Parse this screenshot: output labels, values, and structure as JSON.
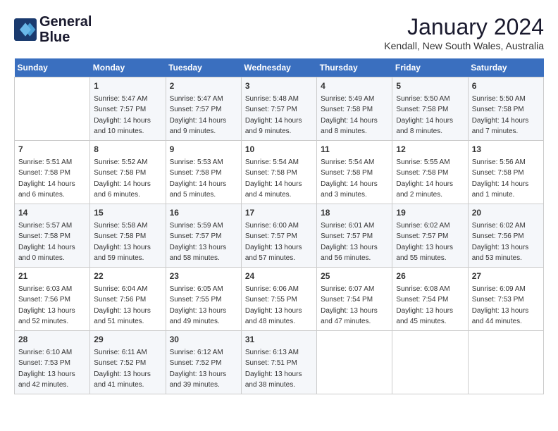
{
  "logo": {
    "line1": "General",
    "line2": "Blue"
  },
  "title": "January 2024",
  "location": "Kendall, New South Wales, Australia",
  "days_of_week": [
    "Sunday",
    "Monday",
    "Tuesday",
    "Wednesday",
    "Thursday",
    "Friday",
    "Saturday"
  ],
  "weeks": [
    [
      {
        "day": "",
        "sunrise": "",
        "sunset": "",
        "daylight": ""
      },
      {
        "day": "1",
        "sunrise": "Sunrise: 5:47 AM",
        "sunset": "Sunset: 7:57 PM",
        "daylight": "Daylight: 14 hours and 10 minutes."
      },
      {
        "day": "2",
        "sunrise": "Sunrise: 5:47 AM",
        "sunset": "Sunset: 7:57 PM",
        "daylight": "Daylight: 14 hours and 9 minutes."
      },
      {
        "day": "3",
        "sunrise": "Sunrise: 5:48 AM",
        "sunset": "Sunset: 7:57 PM",
        "daylight": "Daylight: 14 hours and 9 minutes."
      },
      {
        "day": "4",
        "sunrise": "Sunrise: 5:49 AM",
        "sunset": "Sunset: 7:58 PM",
        "daylight": "Daylight: 14 hours and 8 minutes."
      },
      {
        "day": "5",
        "sunrise": "Sunrise: 5:50 AM",
        "sunset": "Sunset: 7:58 PM",
        "daylight": "Daylight: 14 hours and 8 minutes."
      },
      {
        "day": "6",
        "sunrise": "Sunrise: 5:50 AM",
        "sunset": "Sunset: 7:58 PM",
        "daylight": "Daylight: 14 hours and 7 minutes."
      }
    ],
    [
      {
        "day": "7",
        "sunrise": "Sunrise: 5:51 AM",
        "sunset": "Sunset: 7:58 PM",
        "daylight": "Daylight: 14 hours and 6 minutes."
      },
      {
        "day": "8",
        "sunrise": "Sunrise: 5:52 AM",
        "sunset": "Sunset: 7:58 PM",
        "daylight": "Daylight: 14 hours and 6 minutes."
      },
      {
        "day": "9",
        "sunrise": "Sunrise: 5:53 AM",
        "sunset": "Sunset: 7:58 PM",
        "daylight": "Daylight: 14 hours and 5 minutes."
      },
      {
        "day": "10",
        "sunrise": "Sunrise: 5:54 AM",
        "sunset": "Sunset: 7:58 PM",
        "daylight": "Daylight: 14 hours and 4 minutes."
      },
      {
        "day": "11",
        "sunrise": "Sunrise: 5:54 AM",
        "sunset": "Sunset: 7:58 PM",
        "daylight": "Daylight: 14 hours and 3 minutes."
      },
      {
        "day": "12",
        "sunrise": "Sunrise: 5:55 AM",
        "sunset": "Sunset: 7:58 PM",
        "daylight": "Daylight: 14 hours and 2 minutes."
      },
      {
        "day": "13",
        "sunrise": "Sunrise: 5:56 AM",
        "sunset": "Sunset: 7:58 PM",
        "daylight": "Daylight: 14 hours and 1 minute."
      }
    ],
    [
      {
        "day": "14",
        "sunrise": "Sunrise: 5:57 AM",
        "sunset": "Sunset: 7:58 PM",
        "daylight": "Daylight: 14 hours and 0 minutes."
      },
      {
        "day": "15",
        "sunrise": "Sunrise: 5:58 AM",
        "sunset": "Sunset: 7:58 PM",
        "daylight": "Daylight: 13 hours and 59 minutes."
      },
      {
        "day": "16",
        "sunrise": "Sunrise: 5:59 AM",
        "sunset": "Sunset: 7:57 PM",
        "daylight": "Daylight: 13 hours and 58 minutes."
      },
      {
        "day": "17",
        "sunrise": "Sunrise: 6:00 AM",
        "sunset": "Sunset: 7:57 PM",
        "daylight": "Daylight: 13 hours and 57 minutes."
      },
      {
        "day": "18",
        "sunrise": "Sunrise: 6:01 AM",
        "sunset": "Sunset: 7:57 PM",
        "daylight": "Daylight: 13 hours and 56 minutes."
      },
      {
        "day": "19",
        "sunrise": "Sunrise: 6:02 AM",
        "sunset": "Sunset: 7:57 PM",
        "daylight": "Daylight: 13 hours and 55 minutes."
      },
      {
        "day": "20",
        "sunrise": "Sunrise: 6:02 AM",
        "sunset": "Sunset: 7:56 PM",
        "daylight": "Daylight: 13 hours and 53 minutes."
      }
    ],
    [
      {
        "day": "21",
        "sunrise": "Sunrise: 6:03 AM",
        "sunset": "Sunset: 7:56 PM",
        "daylight": "Daylight: 13 hours and 52 minutes."
      },
      {
        "day": "22",
        "sunrise": "Sunrise: 6:04 AM",
        "sunset": "Sunset: 7:56 PM",
        "daylight": "Daylight: 13 hours and 51 minutes."
      },
      {
        "day": "23",
        "sunrise": "Sunrise: 6:05 AM",
        "sunset": "Sunset: 7:55 PM",
        "daylight": "Daylight: 13 hours and 49 minutes."
      },
      {
        "day": "24",
        "sunrise": "Sunrise: 6:06 AM",
        "sunset": "Sunset: 7:55 PM",
        "daylight": "Daylight: 13 hours and 48 minutes."
      },
      {
        "day": "25",
        "sunrise": "Sunrise: 6:07 AM",
        "sunset": "Sunset: 7:54 PM",
        "daylight": "Daylight: 13 hours and 47 minutes."
      },
      {
        "day": "26",
        "sunrise": "Sunrise: 6:08 AM",
        "sunset": "Sunset: 7:54 PM",
        "daylight": "Daylight: 13 hours and 45 minutes."
      },
      {
        "day": "27",
        "sunrise": "Sunrise: 6:09 AM",
        "sunset": "Sunset: 7:53 PM",
        "daylight": "Daylight: 13 hours and 44 minutes."
      }
    ],
    [
      {
        "day": "28",
        "sunrise": "Sunrise: 6:10 AM",
        "sunset": "Sunset: 7:53 PM",
        "daylight": "Daylight: 13 hours and 42 minutes."
      },
      {
        "day": "29",
        "sunrise": "Sunrise: 6:11 AM",
        "sunset": "Sunset: 7:52 PM",
        "daylight": "Daylight: 13 hours and 41 minutes."
      },
      {
        "day": "30",
        "sunrise": "Sunrise: 6:12 AM",
        "sunset": "Sunset: 7:52 PM",
        "daylight": "Daylight: 13 hours and 39 minutes."
      },
      {
        "day": "31",
        "sunrise": "Sunrise: 6:13 AM",
        "sunset": "Sunset: 7:51 PM",
        "daylight": "Daylight: 13 hours and 38 minutes."
      },
      {
        "day": "",
        "sunrise": "",
        "sunset": "",
        "daylight": ""
      },
      {
        "day": "",
        "sunrise": "",
        "sunset": "",
        "daylight": ""
      },
      {
        "day": "",
        "sunrise": "",
        "sunset": "",
        "daylight": ""
      }
    ]
  ]
}
